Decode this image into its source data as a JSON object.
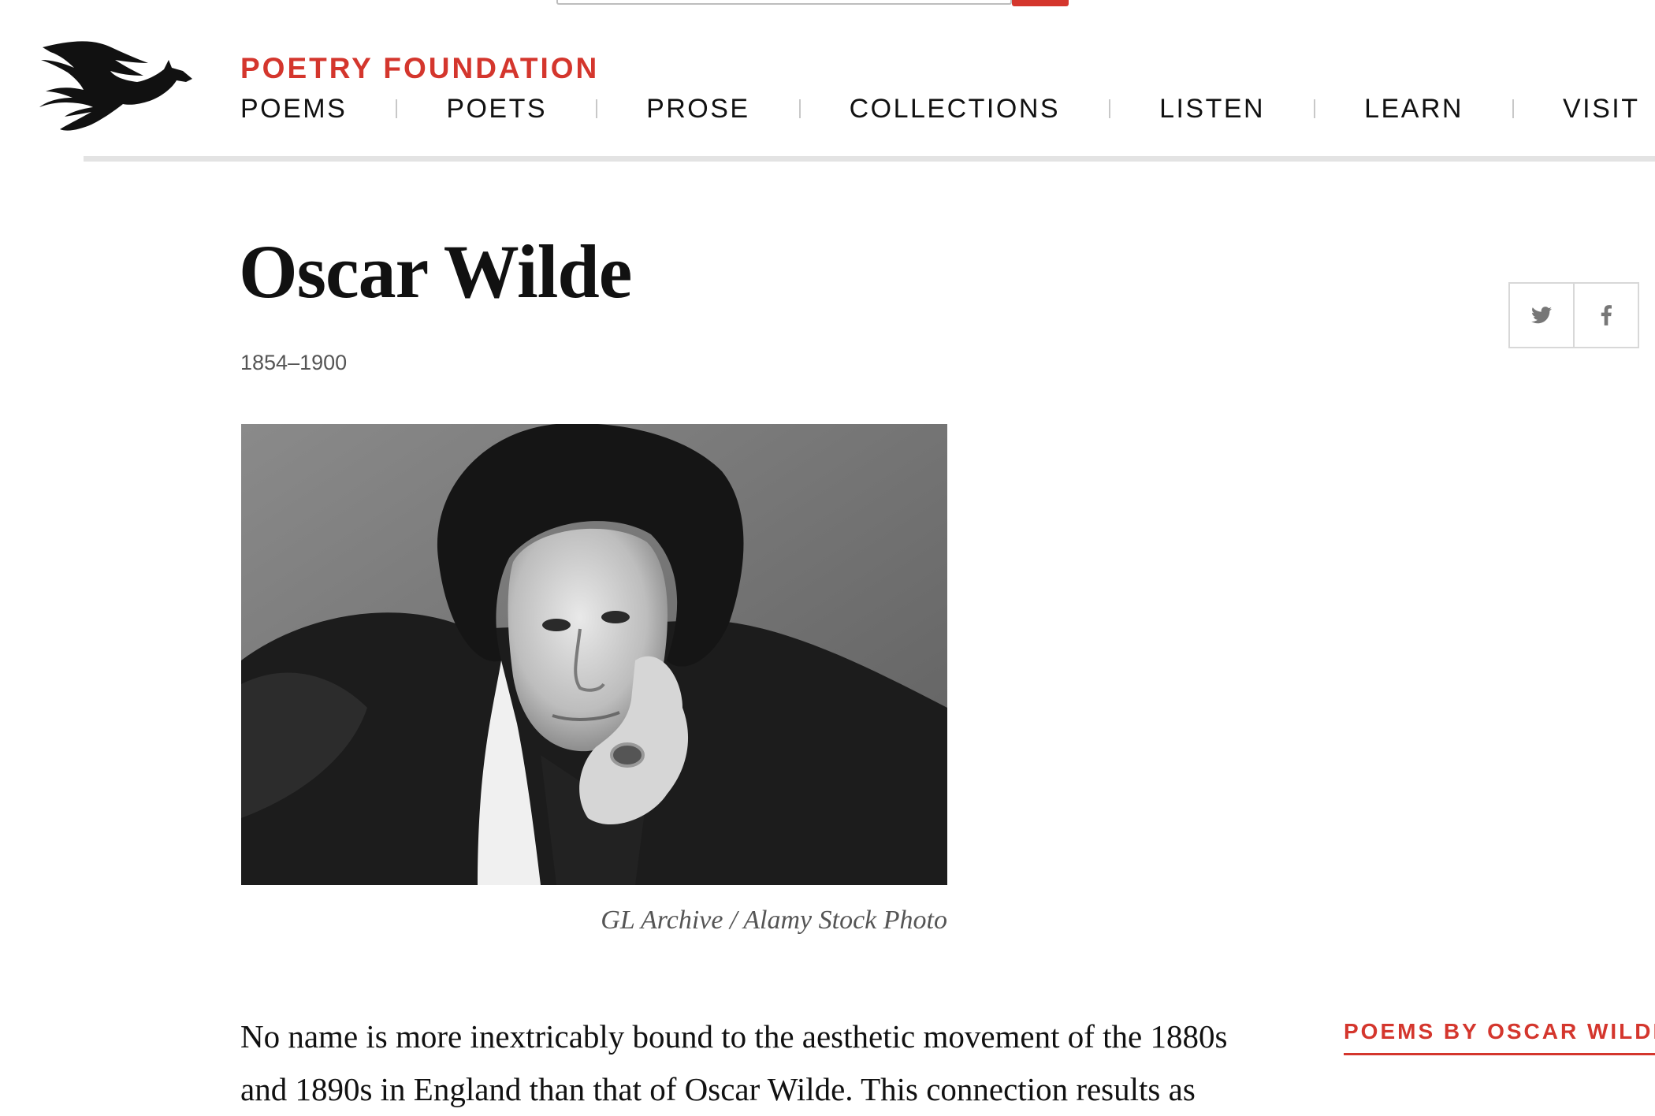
{
  "brand": {
    "name": "POETRY FOUNDATION",
    "logo_icon": "pegasus-icon"
  },
  "nav": {
    "items": [
      "POEMS",
      "POETS",
      "PROSE",
      "COLLECTIONS",
      "LISTEN",
      "LEARN",
      "VISIT"
    ]
  },
  "poet": {
    "name": "Oscar Wilde",
    "dates": "1854–1900"
  },
  "share": {
    "icons": [
      "twitter-icon",
      "facebook-icon"
    ]
  },
  "image": {
    "caption": "GL Archive / Alamy Stock Photo"
  },
  "bio": {
    "text": "No name is more inextricably bound to the aesthetic movement of the 1880s and 1890s in England than that of Oscar Wilde. This connection results as"
  },
  "sidebar": {
    "heading": "POEMS BY OSCAR WILDE"
  },
  "colors": {
    "accent": "#d4362d",
    "text": "#111111",
    "muted": "#555555",
    "rule": "#e3e3e3"
  }
}
